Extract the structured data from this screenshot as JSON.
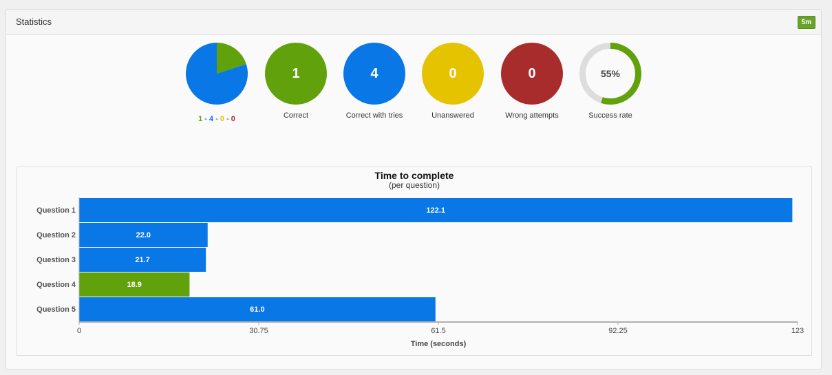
{
  "panel": {
    "title": "Statistics",
    "badge": "5m"
  },
  "summary": {
    "pie": {
      "caption_parts": [
        {
          "text": "1",
          "color": "#61a20c"
        },
        {
          "text": " - ",
          "color": "#333333"
        },
        {
          "text": "4",
          "color": "#0a77e6"
        },
        {
          "text": " - ",
          "color": "#333333"
        },
        {
          "text": "0",
          "color": "#e5c300"
        },
        {
          "text": " - ",
          "color": "#333333"
        },
        {
          "text": "0",
          "color": "#a82c2c"
        }
      ],
      "slices": [
        {
          "name": "Correct",
          "value": 1,
          "color": "#61a20c"
        },
        {
          "name": "Correct with tries",
          "value": 4,
          "color": "#0a77e6"
        },
        {
          "name": "Unanswered",
          "value": 0,
          "color": "#e5c300"
        },
        {
          "name": "Wrong attempts",
          "value": 0,
          "color": "#a82c2c"
        }
      ]
    },
    "correct": {
      "value": "1",
      "label": "Correct",
      "color": "#61a20c"
    },
    "correct_with_tries": {
      "value": "4",
      "label": "Correct with tries",
      "color": "#0a77e6"
    },
    "unanswered": {
      "value": "0",
      "label": "Unanswered",
      "color": "#e5c300"
    },
    "wrong_attempts": {
      "value": "0",
      "label": "Wrong attempts",
      "color": "#a82c2c"
    },
    "success_rate": {
      "value": "55%",
      "fraction": 0.55,
      "label": "Success rate",
      "color": "#61a20c",
      "track_color": "#dddddd"
    }
  },
  "chart_data": {
    "type": "bar",
    "orientation": "horizontal",
    "title": "Time to complete",
    "subtitle": "(per question)",
    "categories": [
      "Question 1",
      "Question 2",
      "Question 3",
      "Question 4",
      "Question 5"
    ],
    "values": [
      122.1,
      22.0,
      21.7,
      18.9,
      61.0
    ],
    "value_labels": [
      "122.1",
      "22.0",
      "21.7",
      "18.9",
      "61.0"
    ],
    "bar_colors": [
      "#0a77e6",
      "#0a77e6",
      "#0a77e6",
      "#61a20c",
      "#0a77e6"
    ],
    "xlabel": "Time (seconds)",
    "xlim": [
      0,
      123
    ],
    "xticks": [
      0,
      30.75,
      61.5,
      92.25,
      123
    ],
    "xtick_labels": [
      "0",
      "30.75",
      "61.5",
      "92.25",
      "123"
    ],
    "grid": false,
    "legend": "none"
  }
}
